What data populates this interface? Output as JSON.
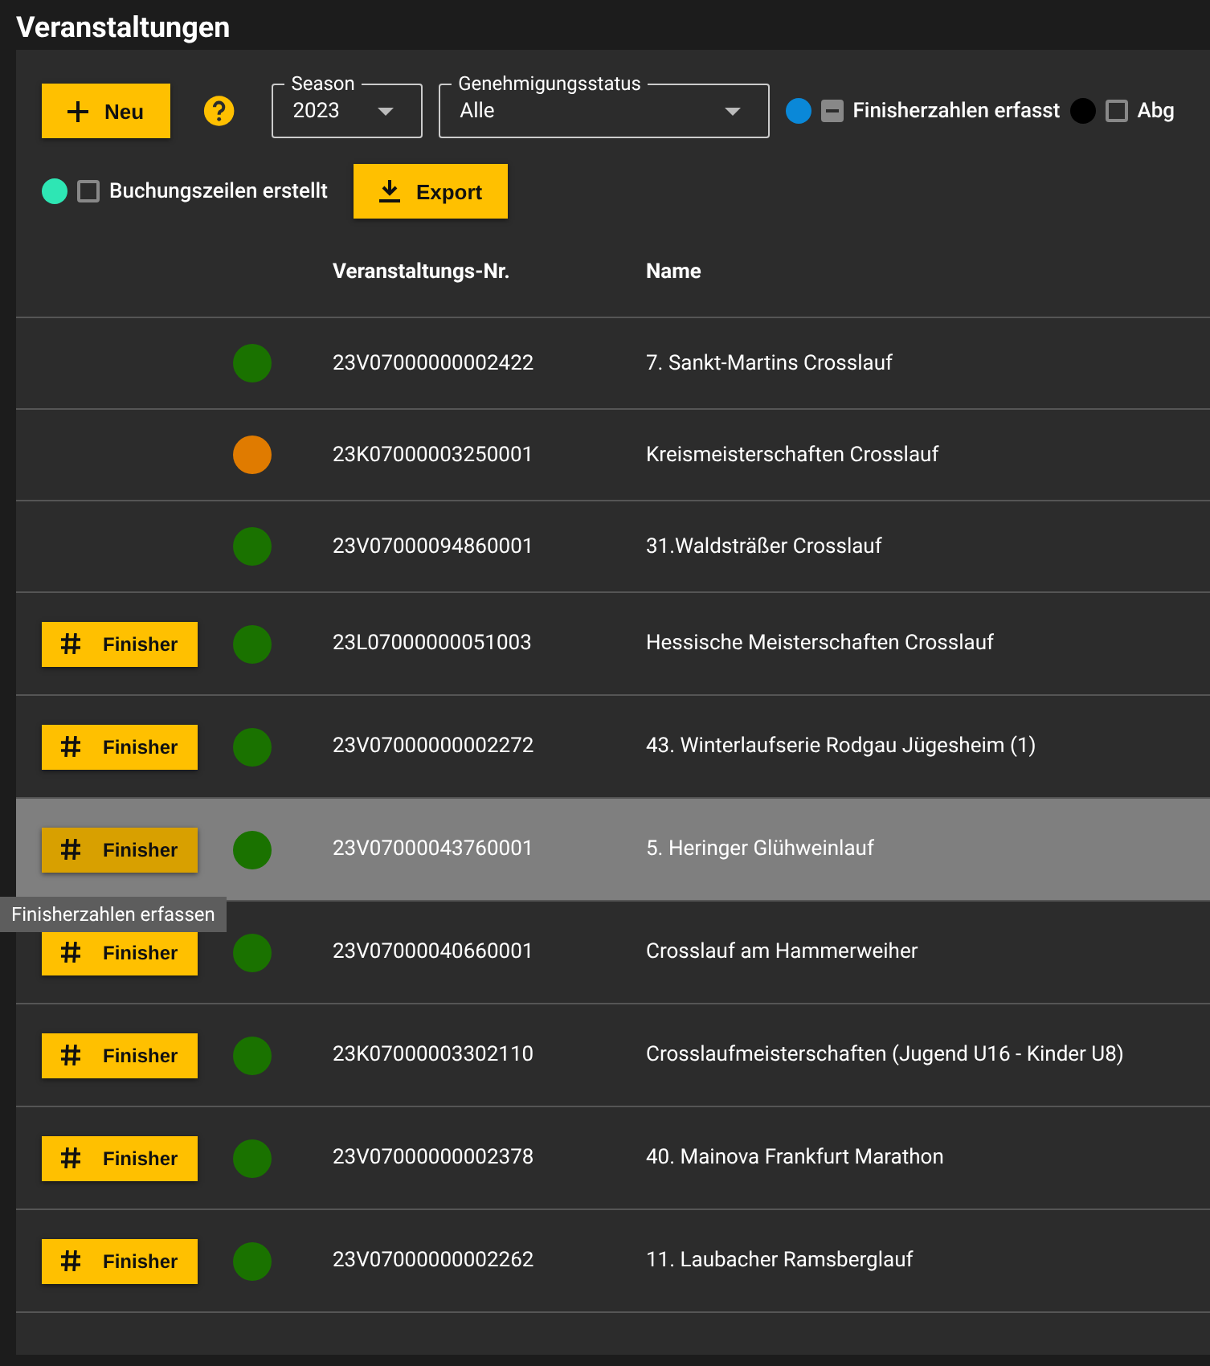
{
  "title": "Veranstaltungen",
  "toolbar": {
    "new_button": "Neu",
    "export_button": "Export",
    "season": {
      "label": "Season",
      "value": "2023"
    },
    "status": {
      "label": "Genehmigungsstatus",
      "value": "Alle"
    },
    "legend": [
      {
        "label": "Finisherzahlen erfasst",
        "color": "#0a88d8",
        "indeterminate": true
      },
      {
        "label": "Abg",
        "color": "#000000",
        "indeterminate": false,
        "checked": false
      },
      {
        "label": "Buchungszeilen erstellt",
        "color": "#2ee6b4",
        "indeterminate": false,
        "checked": false
      }
    ]
  },
  "table": {
    "columns": [
      "Veranstaltungs-Nr.",
      "Name"
    ],
    "rows": [
      {
        "button": null,
        "color": "#1a7200",
        "number": "23V07000000002422",
        "name": "7. Sankt-Martins Crosslauf",
        "selected": false
      },
      {
        "button": null,
        "color": "#e07b00",
        "number": "23K07000003250001",
        "name": "Kreismeisterschaften Crosslauf",
        "selected": false
      },
      {
        "button": null,
        "color": "#1a7200",
        "number": "23V07000094860001",
        "name": "31.Waldsträßer Crosslauf",
        "selected": false
      },
      {
        "button": "Finisher",
        "color": "#1a7200",
        "number": "23L07000000051003",
        "name": "Hessische Meisterschaften Crosslauf",
        "selected": false
      },
      {
        "button": "Finisher",
        "color": "#1a7200",
        "number": "23V07000000002272",
        "name": "43. Winterlaufserie Rodgau Jügesheim (1)",
        "selected": false
      },
      {
        "button": "Finisher",
        "color": "#1a7200",
        "number": "23V07000043760001",
        "name": "5. Heringer Glühweinlauf",
        "selected": true,
        "tooltip": "Finisherzahlen erfassen"
      },
      {
        "button": "Finisher",
        "color": "#1a7200",
        "number": "23V07000040660001",
        "name": "Crosslauf am Hammerweiher",
        "selected": false
      },
      {
        "button": "Finisher",
        "color": "#1a7200",
        "number": "23K07000003302110",
        "name": "Crosslaufmeisterschaften (Jugend U16 - Kinder U8)",
        "selected": false
      },
      {
        "button": "Finisher",
        "color": "#1a7200",
        "number": "23V07000000002378",
        "name": "40. Mainova Frankfurt Marathon",
        "selected": false
      },
      {
        "button": "Finisher",
        "color": "#1a7200",
        "number": "23V07000000002262",
        "name": "11. Laubacher Ramsberglauf",
        "selected": false
      }
    ]
  }
}
